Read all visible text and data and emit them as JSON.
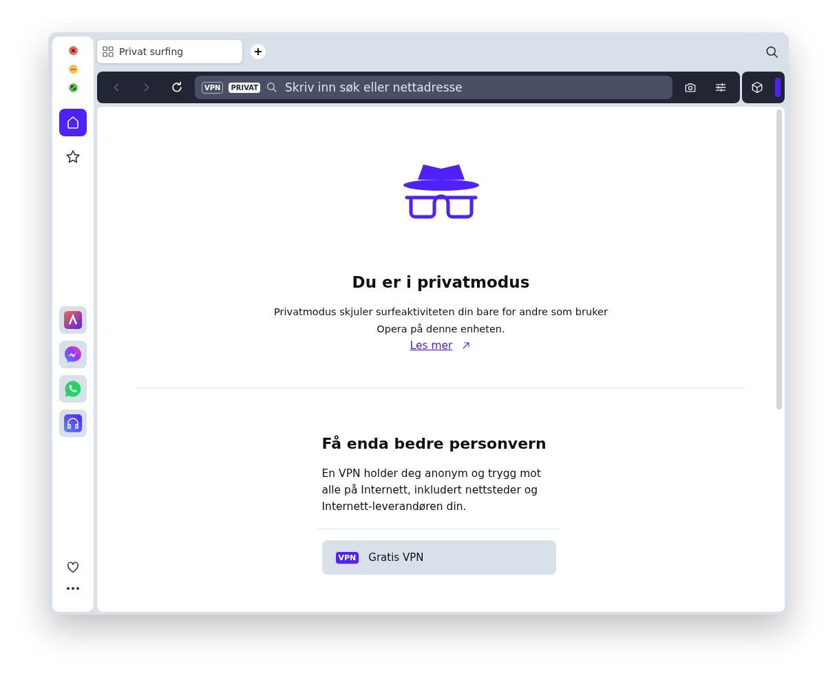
{
  "window": {
    "controls": [
      {
        "kind": "close",
        "color": "#ec6a5e"
      },
      {
        "kind": "minimize",
        "color": "#f4bf4f"
      },
      {
        "kind": "zoom",
        "color": "#61c554"
      }
    ]
  },
  "sidebar": {
    "nav": [
      {
        "kind": "home",
        "selected": true
      },
      {
        "kind": "bookmarks",
        "selected": false
      }
    ],
    "apps": [
      {
        "kind": "aria"
      },
      {
        "kind": "messenger"
      },
      {
        "kind": "whatsapp"
      },
      {
        "kind": "music"
      }
    ],
    "bottom": [
      {
        "kind": "favorites"
      },
      {
        "kind": "more"
      }
    ]
  },
  "tabs": [
    {
      "label": "Privat surfing",
      "selected": true
    }
  ],
  "toolbar": {
    "back_disabled": true,
    "forward_disabled": true,
    "badges": [
      "VPN",
      "PRIVAT"
    ],
    "address": {
      "placeholder": "Skriv inn søk eller nettadresse"
    }
  },
  "content": {
    "title": "Du er i privatmodus",
    "text": "Privatmodus skjuler surfeaktiviteten din bare for andre som bruker Opera på denne enheten.",
    "link": "Les mer",
    "vpn": {
      "title": "Få enda bedre personvern",
      "text": "En VPN holder deg anonym og trygg mot alle på Internett, inkludert nettsteder og Internett-leverandøren din.",
      "button_badge": "VPN",
      "button": "Gratis VPN"
    }
  }
}
